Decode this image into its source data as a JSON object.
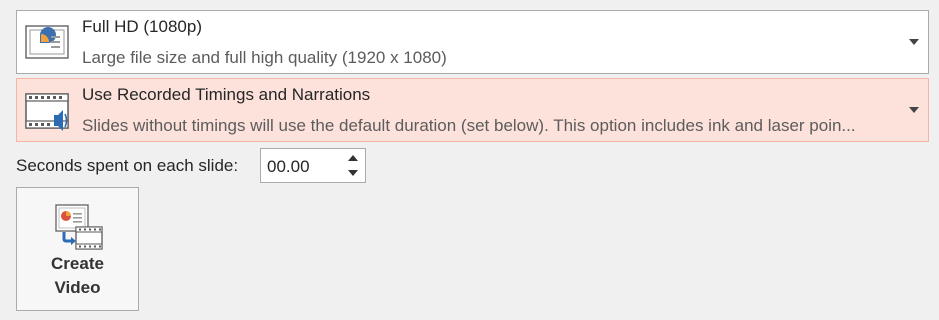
{
  "quality_dropdown": {
    "title": "Full HD (1080p)",
    "description": "Large file size and full high quality (1920 x 1080)",
    "icon": "presentation-slide-icon"
  },
  "timings_dropdown": {
    "title": "Use Recorded Timings and Narrations",
    "description": "Slides without timings will use the default duration (set below). This option includes ink and laser poin...",
    "icon": "filmstrip-speaker-icon",
    "highlight_color": "#fde2dc"
  },
  "seconds": {
    "label": "Seconds spent on each slide:",
    "value": "00.00"
  },
  "create_video": {
    "label": "Create\nVideo",
    "icon": "create-video-icon"
  }
}
